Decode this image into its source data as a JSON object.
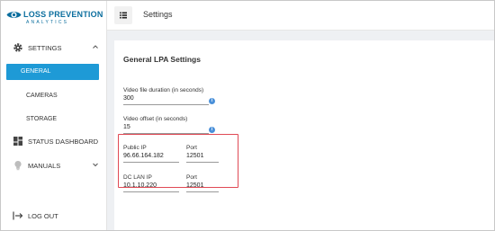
{
  "brand": {
    "title": "LOSS PREVENTION",
    "subtitle": "ANALYTICS",
    "color": "#0b6e9e"
  },
  "sidebar": {
    "settings_label": "SETTINGS",
    "sub_items": [
      {
        "label": "GENERAL",
        "active": true
      },
      {
        "label": "CAMERAS",
        "active": false
      },
      {
        "label": "STORAGE",
        "active": false
      }
    ],
    "status_dashboard_label": "STATUS DASHBOARD",
    "manuals_label": "MANUALS",
    "logout_label": "LOG OUT",
    "accent_color": "#1e9ad6"
  },
  "header": {
    "title": "Settings"
  },
  "main": {
    "card_title": "General LPA Settings",
    "video_duration": {
      "label": "Video file duration (in seconds)",
      "value": "300"
    },
    "video_offset": {
      "label": "Video offset (in seconds)",
      "value": "15"
    },
    "public_ip": {
      "label": "Public IP",
      "value": "96.66.164.182"
    },
    "public_port": {
      "label": "Port",
      "value": "12501"
    },
    "dc_lan_ip": {
      "label": "DC LAN IP",
      "value": "10.1.10.220"
    },
    "dc_port": {
      "label": "Port",
      "value": "12501"
    },
    "highlight_color": "#e04a55"
  }
}
